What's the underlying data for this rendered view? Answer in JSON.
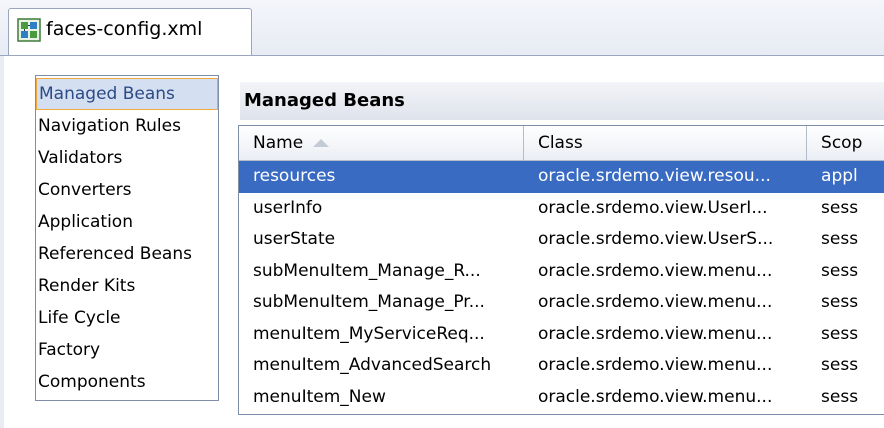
{
  "tab": {
    "title": "faces-config.xml",
    "icon": "faces-config-icon"
  },
  "nav": {
    "items": [
      {
        "label": "Managed Beans",
        "selected": true
      },
      {
        "label": "Navigation Rules",
        "selected": false
      },
      {
        "label": "Validators",
        "selected": false
      },
      {
        "label": "Converters",
        "selected": false
      },
      {
        "label": "Application",
        "selected": false
      },
      {
        "label": "Referenced Beans",
        "selected": false
      },
      {
        "label": "Render Kits",
        "selected": false
      },
      {
        "label": "Life Cycle",
        "selected": false
      },
      {
        "label": "Factory",
        "selected": false
      },
      {
        "label": "Components",
        "selected": false
      }
    ]
  },
  "section": {
    "title": "Managed Beans"
  },
  "table": {
    "columns": [
      "Name",
      "Class",
      "Scop"
    ],
    "sort_column": "Name",
    "sort_direction": "ascending",
    "rows": [
      {
        "name": "resources",
        "class": "oracle.srdemo.view.resou...",
        "scope": "appl",
        "selected": true
      },
      {
        "name": "userInfo",
        "class": "oracle.srdemo.view.UserI...",
        "scope": "sess",
        "selected": false
      },
      {
        "name": "userState",
        "class": "oracle.srdemo.view.UserS...",
        "scope": "sess",
        "selected": false
      },
      {
        "name": "subMenuItem_Manage_R...",
        "class": "oracle.srdemo.view.menu...",
        "scope": "sess",
        "selected": false
      },
      {
        "name": "subMenuItem_Manage_Pr...",
        "class": "oracle.srdemo.view.menu...",
        "scope": "sess",
        "selected": false
      },
      {
        "name": "menuItem_MyServiceReq...",
        "class": "oracle.srdemo.view.menu...",
        "scope": "sess",
        "selected": false
      },
      {
        "name": "menuItem_AdvancedSearch",
        "class": "oracle.srdemo.view.menu...",
        "scope": "sess",
        "selected": false
      },
      {
        "name": "menuItem_New",
        "class": "oracle.srdemo.view.menu...",
        "scope": "sess",
        "selected": false
      }
    ]
  },
  "colors": {
    "selected_row": "#3a6bc3",
    "nav_selected_border": "#f0a83a",
    "nav_selected_bg": "#d5dff2"
  }
}
